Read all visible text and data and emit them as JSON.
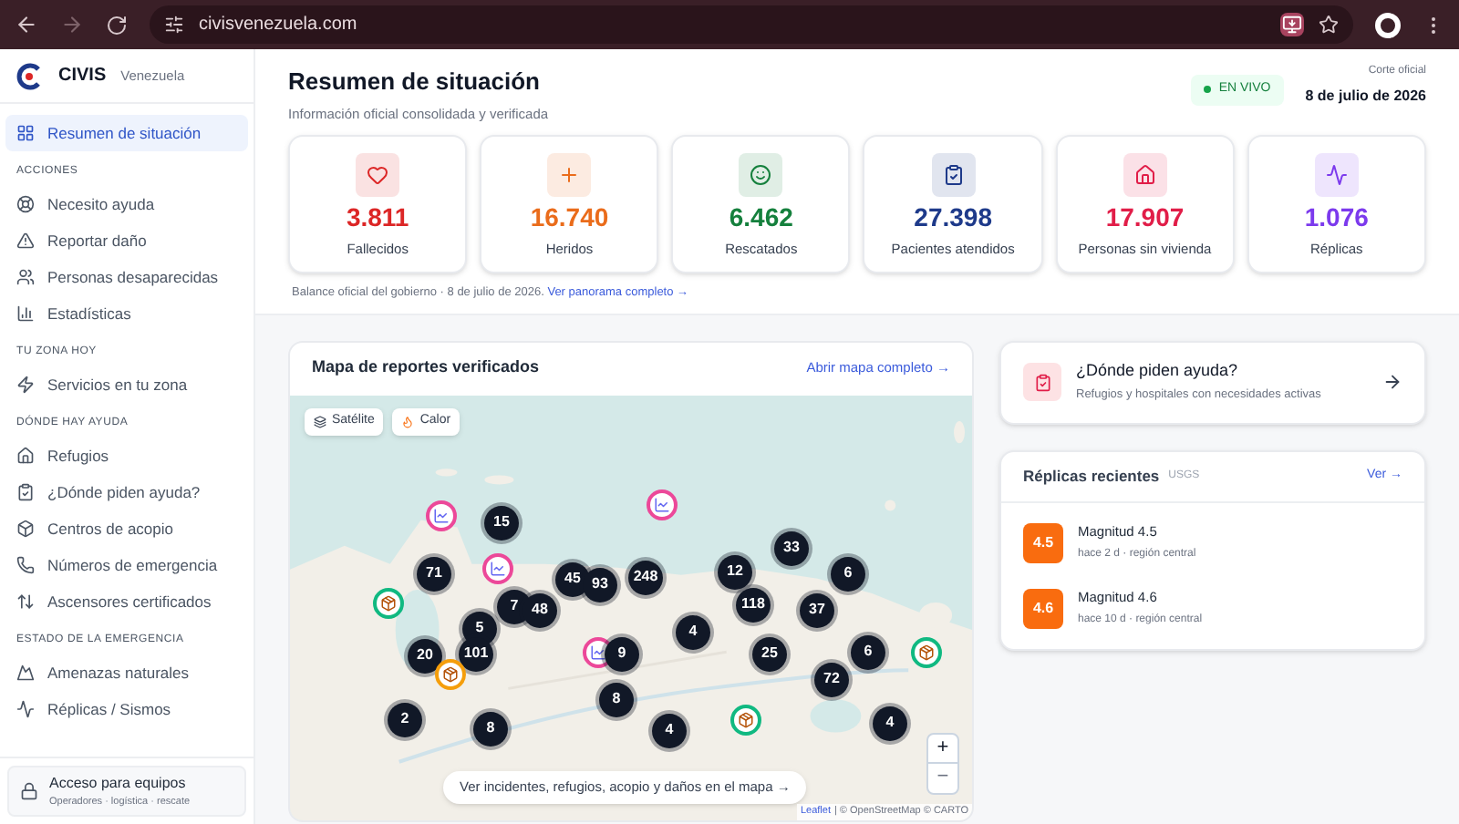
{
  "browser": {
    "url": "civisvenezuela.com"
  },
  "sidebar": {
    "brand": {
      "name": "CIVIS",
      "region": "Venezuela"
    },
    "groups": [
      {
        "items": [
          {
            "label": "Resumen de situación",
            "selected": true
          }
        ]
      },
      {
        "heading": "ACCIONES",
        "items": [
          {
            "label": "Necesito ayuda",
            "selected": false
          },
          {
            "label": "Reportar daño",
            "selected": false
          },
          {
            "label": "Personas desaparecidas",
            "selected": false
          },
          {
            "label": "Estadísticas",
            "selected": false
          }
        ]
      },
      {
        "heading": "TU ZONA HOY",
        "items": [
          {
            "label": "Servicios en tu zona",
            "selected": false
          }
        ]
      },
      {
        "heading": "DÓNDE HAY AYUDA",
        "items": [
          {
            "label": "Refugios",
            "selected": false
          },
          {
            "label": "¿Dónde piden ayuda?",
            "selected": false
          },
          {
            "label": "Centros de acopio",
            "selected": false
          },
          {
            "label": "Números de emergencia",
            "selected": false
          },
          {
            "label": "Ascensores certificados",
            "selected": false
          }
        ]
      },
      {
        "heading": "ESTADO DE LA EMERGENCIA",
        "items": [
          {
            "label": "Amenazas naturales",
            "selected": false
          },
          {
            "label": "Réplicas / Sismos",
            "selected": false
          }
        ]
      }
    ],
    "footer": {
      "title": "Acceso para equipos",
      "subtitle": "Operadores · logística · rescate"
    }
  },
  "header": {
    "title": "Resumen de situación",
    "subtitle": "Información oficial consolidada y verificada",
    "live": "EN VIVO",
    "cut_label": "Corte oficial",
    "cut_date": "8 de julio de 2026"
  },
  "stats": [
    {
      "value": "3.811",
      "label": "Fallecidos",
      "color": "#dc2626"
    },
    {
      "value": "16.740",
      "label": "Heridos",
      "color": "#ea6c1b"
    },
    {
      "value": "6.462",
      "label": "Rescatados",
      "color": "#15803d"
    },
    {
      "value": "27.398",
      "label": "Pacientes atendidos",
      "color": "#1e3a8a"
    },
    {
      "value": "17.907",
      "label": "Personas sin vivienda",
      "color": "#e11d48"
    },
    {
      "value": "1.076",
      "label": "Réplicas",
      "color": "#7c3aed"
    }
  ],
  "balance": {
    "text": "Balance oficial del gobierno · 8 de julio de 2026.",
    "link": "Ver panorama completo →"
  },
  "map": {
    "title": "Mapa de reportes verificados",
    "link": "Abrir mapa completo →",
    "layers": [
      "Satélite",
      "Calor"
    ],
    "markers": [
      {
        "kind": "report"
      },
      {
        "kind": "cluster",
        "count": "15"
      },
      {
        "kind": "report"
      },
      {
        "kind": "cluster",
        "count": "33"
      },
      {
        "kind": "cluster",
        "count": "71"
      },
      {
        "kind": "report"
      },
      {
        "kind": "cluster",
        "count": "45"
      },
      {
        "kind": "cluster",
        "count": "93"
      },
      {
        "kind": "cluster",
        "count": "248"
      },
      {
        "kind": "cluster",
        "count": "12"
      },
      {
        "kind": "cluster",
        "count": "6"
      },
      {
        "kind": "shelter"
      },
      {
        "kind": "cluster",
        "count": "7"
      },
      {
        "kind": "cluster",
        "count": "48"
      },
      {
        "kind": "cluster",
        "count": "118"
      },
      {
        "kind": "cluster",
        "count": "37"
      },
      {
        "kind": "cluster",
        "count": "5"
      },
      {
        "kind": "cluster",
        "count": "4"
      },
      {
        "kind": "cluster",
        "count": "20"
      },
      {
        "kind": "cluster",
        "count": "101"
      },
      {
        "kind": "report"
      },
      {
        "kind": "cluster",
        "count": "9"
      },
      {
        "kind": "cluster",
        "count": "25"
      },
      {
        "kind": "cluster",
        "count": "6"
      },
      {
        "kind": "shelter"
      },
      {
        "kind": "collection"
      },
      {
        "kind": "cluster",
        "count": "72"
      },
      {
        "kind": "cluster",
        "count": "8"
      },
      {
        "kind": "cluster",
        "count": "2"
      },
      {
        "kind": "cluster",
        "count": "8"
      },
      {
        "kind": "cluster",
        "count": "4"
      },
      {
        "kind": "shelter"
      },
      {
        "kind": "cluster",
        "count": "4"
      }
    ],
    "cta": "Ver incidentes, refugios, acopio y daños en el mapa →",
    "zoom_in": "+",
    "zoom_out": "−",
    "attribution": [
      "Leaflet",
      "| © OpenStreetMap © CARTO"
    ]
  },
  "help_card": {
    "title": "¿Dónde piden ayuda?",
    "subtitle": "Refugios y hospitales con necesidades activas"
  },
  "replicas": {
    "title": "Réplicas recientes",
    "source": "USGS",
    "link": "Ver →",
    "items": [
      {
        "magnitude": "4.5",
        "title": "Magnitud 4.5",
        "detail": "hace 2 d · región central"
      },
      {
        "magnitude": "4.6",
        "title": "Magnitud 4.6",
        "detail": "hace 10 d · región central"
      }
    ]
  }
}
